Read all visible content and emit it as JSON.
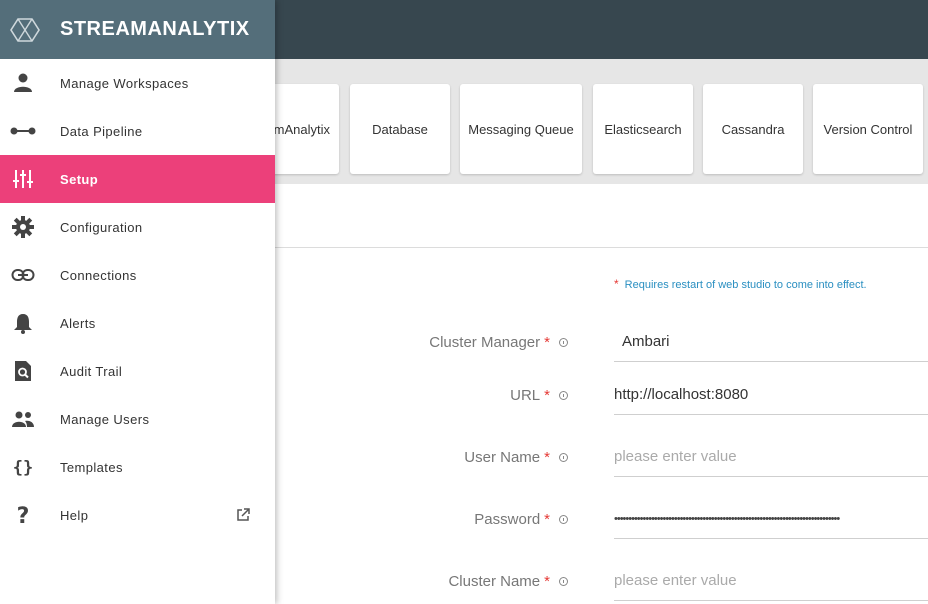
{
  "brand": {
    "name": "STREAMANALYTIX"
  },
  "tabs": [
    {
      "label": "mAnalytix"
    },
    {
      "label": "Database"
    },
    {
      "label": "Messaging Queue"
    },
    {
      "label": "Elasticsearch"
    },
    {
      "label": "Cassandra"
    },
    {
      "label": "Version Control"
    }
  ],
  "notice": {
    "star": "*",
    "text": "Requires restart of web studio to come into effect."
  },
  "form": {
    "cluster_manager": {
      "label": "Cluster Manager",
      "req": "*",
      "value": "Ambari"
    },
    "url": {
      "label": "URL",
      "req": "*",
      "value": "http://localhost:8080"
    },
    "user_name": {
      "label": "User Name",
      "req": "*",
      "placeholder": "please enter value"
    },
    "password": {
      "label": "Password",
      "req": "*",
      "value": "•••••••••••••••••••••••••••••••••••••••••••••••••••••••••••••••••••••••••••••••"
    },
    "cluster_name": {
      "label": "Cluster Name",
      "req": "*",
      "placeholder": "please enter value"
    }
  },
  "nav": [
    {
      "label": "Manage Workspaces",
      "icon": "person-icon"
    },
    {
      "label": "Data Pipeline",
      "icon": "pipeline-icon"
    },
    {
      "label": "Setup",
      "icon": "sliders-icon",
      "active": true
    },
    {
      "label": "Configuration",
      "icon": "gear-icon"
    },
    {
      "label": "Connections",
      "icon": "link-icon"
    },
    {
      "label": "Alerts",
      "icon": "bell-icon"
    },
    {
      "label": "Audit Trail",
      "icon": "file-search-icon"
    },
    {
      "label": "Manage Users",
      "icon": "people-icon"
    },
    {
      "label": "Templates",
      "icon": "braces-icon"
    },
    {
      "label": "Help",
      "icon": "question-icon"
    }
  ],
  "colors": {
    "topbar": "#37474f",
    "drawer_head": "#546e7a",
    "accent": "#ec407a",
    "required": "#e53935",
    "notice": "#2a8fc1"
  }
}
